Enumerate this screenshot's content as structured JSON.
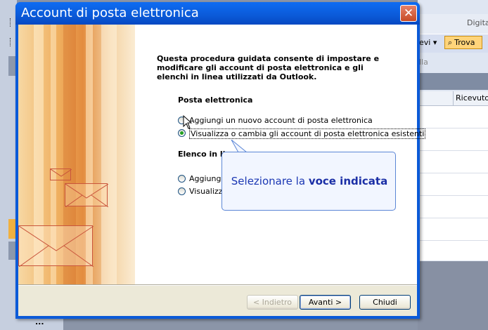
{
  "background": {
    "search_placeholder": "Digita",
    "toolbar_partial": "evi",
    "find_button": "Trova",
    "filter_partial": "lla",
    "column_received": "Ricevuto",
    "dots": "..."
  },
  "dialog": {
    "title": "Account di posta elettronica",
    "close_glyph": "✕",
    "intro": "Questa procedura guidata consente di impostare e modificare gli account di posta elettronica e gli elenchi in linea utilizzati da Outlook.",
    "email_section": {
      "heading": "Posta elettronica",
      "options": [
        {
          "label": "Aggiungi un nuovo account di posta elettronica",
          "checked": false
        },
        {
          "label": "Visualizza o cambia gli account di posta elettronica esistenti",
          "checked": true
        }
      ]
    },
    "directory_section": {
      "heading_partial": "Elenco in lin",
      "options": [
        {
          "label_partial": "Aggiungi u",
          "checked": false
        },
        {
          "label_partial": "Visualizza",
          "checked": false
        }
      ]
    },
    "buttons": {
      "back": "< Indietro",
      "next": "Avanti >",
      "close": "Chiudi"
    }
  },
  "callout": {
    "text_prefix": "Selezionare la ",
    "text_bold": "voce indicata"
  },
  "colors": {
    "title_bar": "#0b5ad8",
    "close_button": "#c74a25",
    "callout_border": "#5b86d6",
    "callout_text": "#1b37b3",
    "radio_checked": "#21a121"
  }
}
